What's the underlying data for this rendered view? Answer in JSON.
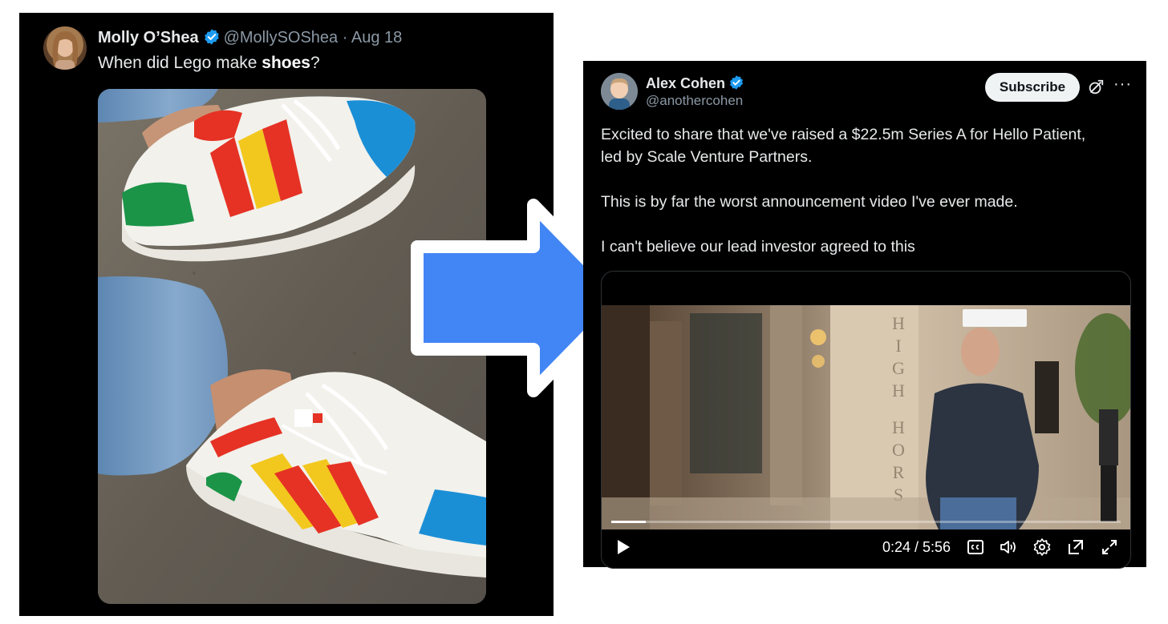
{
  "left_tweet": {
    "name": "Molly O’Shea",
    "handle": "@MollySOShea",
    "separator": "·",
    "date": "Aug 18",
    "text_prefix": "When did Lego make ",
    "text_bold": "shoes",
    "text_suffix": "?"
  },
  "right_tweet": {
    "name": "Alex Cohen",
    "handle": "@anothercohen",
    "subscribe_label": "Subscribe",
    "more_label": "···",
    "lines": [
      "Excited to share that we've raised a $22.5m Series A for Hello Patient,",
      "led by Scale Venture Partners.",
      "This is by far the worst announcement video I've ever made.",
      "I can't believe our lead investor agreed to this"
    ],
    "video": {
      "time": "0:24 / 5:56",
      "progress": 0.068
    }
  },
  "colors": {
    "arrow_fill": "#4285f4",
    "verified": "#1d9bf0"
  }
}
